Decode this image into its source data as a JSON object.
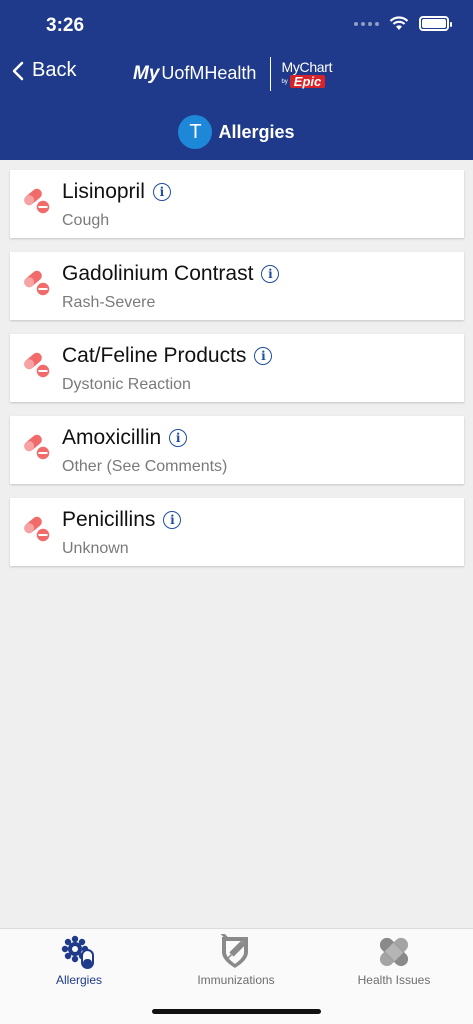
{
  "status_bar": {
    "time": "3:26"
  },
  "nav": {
    "back_label": "Back",
    "logo_my": "My",
    "logo_uofm": "UofMHealth",
    "mychart_label": "MyChart",
    "mychart_by": "by",
    "epic_label": "Epic"
  },
  "page": {
    "avatar_initial": "T",
    "title": "Allergies"
  },
  "colors": {
    "header": "#1f3a8a",
    "avatar": "#1e88d8",
    "pill": "#f26b6b",
    "active_tab": "#1f3a8a"
  },
  "allergies": [
    {
      "name": "Lisinopril",
      "reaction": "Cough"
    },
    {
      "name": "Gadolinium Contrast",
      "reaction": "Rash-Severe"
    },
    {
      "name": "Cat/Feline Products",
      "reaction": "Dystonic Reaction"
    },
    {
      "name": "Amoxicillin",
      "reaction": "Other (See Comments)"
    },
    {
      "name": "Penicillins",
      "reaction": "Unknown"
    }
  ],
  "tabs": [
    {
      "label": "Allergies",
      "icon": "allergies-icon",
      "active": true
    },
    {
      "label": "Immunizations",
      "icon": "syringe-shield-icon",
      "active": false
    },
    {
      "label": "Health Issues",
      "icon": "bandage-icon",
      "active": false
    }
  ]
}
